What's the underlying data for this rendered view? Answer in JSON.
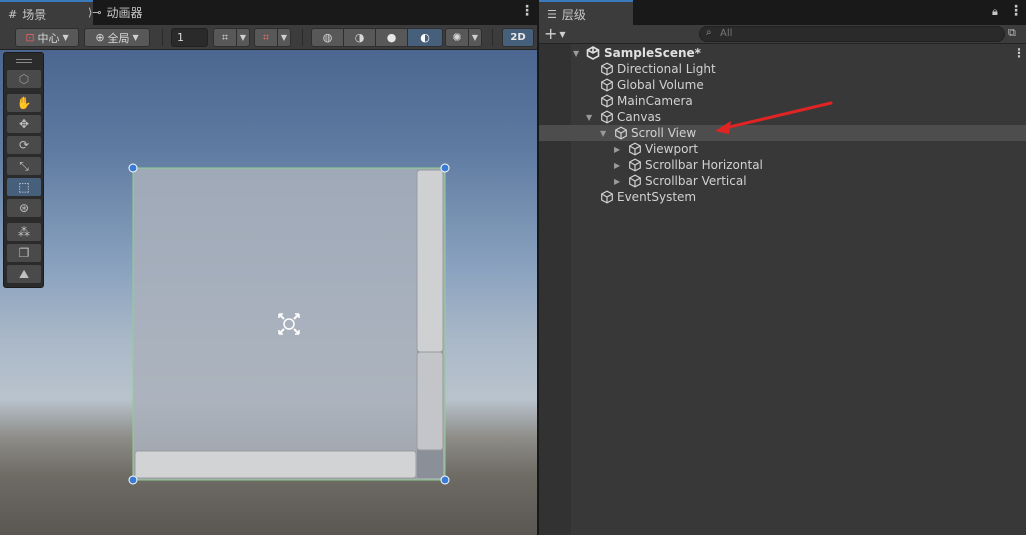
{
  "scene_tabs": [
    {
      "label": "场景",
      "icon": "grid-icon"
    },
    {
      "label": "动画器",
      "icon": "animator-icon"
    }
  ],
  "scene_toolbar": {
    "pivot_label": "中心",
    "space_label": "全局",
    "step_value": "1",
    "mode_2d_label": "2D"
  },
  "hierarchy": {
    "tab_label": "层级",
    "search_placeholder": "All",
    "scene_name": "SampleScene*",
    "items": [
      {
        "label": "Directional Light",
        "depth": 1,
        "expander": "none",
        "selected": false
      },
      {
        "label": "Global Volume",
        "depth": 1,
        "expander": "none",
        "selected": false
      },
      {
        "label": "MainCamera",
        "depth": 1,
        "expander": "none",
        "selected": false
      },
      {
        "label": "Canvas",
        "depth": 1,
        "expander": "expanded",
        "selected": false
      },
      {
        "label": "Scroll View",
        "depth": 2,
        "expander": "expanded",
        "selected": true
      },
      {
        "label": "Viewport",
        "depth": 3,
        "expander": "collapsed",
        "selected": false
      },
      {
        "label": "Scrollbar Horizontal",
        "depth": 3,
        "expander": "collapsed",
        "selected": false
      },
      {
        "label": "Scrollbar Vertical",
        "depth": 3,
        "expander": "collapsed",
        "selected": false
      },
      {
        "label": "EventSystem",
        "depth": 1,
        "expander": "none",
        "selected": false
      }
    ]
  },
  "colors": {
    "accent_blue": "#46607c",
    "annotation_arrow": "#e02424",
    "selection_handle": "#3a7bd5"
  }
}
